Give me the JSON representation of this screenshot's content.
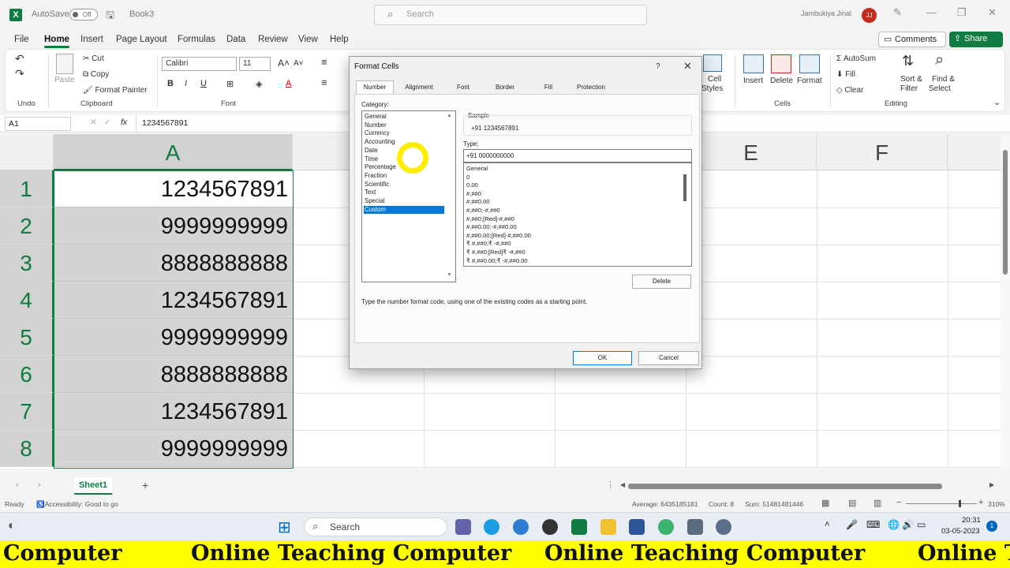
{
  "titlebar": {
    "app_icon": "X",
    "autosave_label": "AutoSave",
    "autosave_state": "Off",
    "workbook": "Book3",
    "search_placeholder": "Search",
    "user_name": "Jambukiya Jinal",
    "user_initials": "JJ"
  },
  "menu": {
    "items": [
      "File",
      "Home",
      "Insert",
      "Page Layout",
      "Formulas",
      "Data",
      "Review",
      "View",
      "Help"
    ],
    "active": "Home",
    "comments_label": "Comments",
    "share_label": "Share"
  },
  "ribbon": {
    "undo_group": "Undo",
    "clipboard": {
      "paste": "Paste",
      "cut": "Cut",
      "copy": "Copy",
      "format_painter": "Format Painter",
      "group": "Clipboard"
    },
    "font": {
      "name": "Calibri",
      "size": "11",
      "group": "Font",
      "bold": "B",
      "italic": "I",
      "underline": "U"
    },
    "cells": {
      "insert": "Insert",
      "delete": "Delete",
      "format": "Format",
      "group": "Cells",
      "cell_styles_1": "Cell",
      "cell_styles_2": "Styles"
    },
    "editing": {
      "autosum": "AutoSum",
      "fill": "Fill",
      "clear": "Clear",
      "sort_1": "Sort &",
      "sort_2": "Filter",
      "find_1": "Find &",
      "find_2": "Select",
      "group": "Editing"
    }
  },
  "formula_bar": {
    "name_box": "A1",
    "fx": "fx",
    "value": "1234567891"
  },
  "grid": {
    "columns": [
      "A",
      "E",
      "F"
    ],
    "rows": [
      "1",
      "2",
      "3",
      "4",
      "5",
      "6",
      "7",
      "8"
    ],
    "values": [
      "1234567891",
      "9999999999",
      "8888888888",
      "1234567891",
      "9999999999",
      "8888888888",
      "1234567891",
      "9999999999"
    ]
  },
  "sheets": {
    "tabs": [
      "Sheet1"
    ],
    "add": "+"
  },
  "status": {
    "ready": "Ready",
    "accessibility": "Accessibility: Good to go",
    "average": "Average: 6435185181",
    "count": "Count: 8",
    "sum": "Sum: 51481481446",
    "zoom": "310%"
  },
  "taskbar": {
    "search": "Search",
    "time": "20:31",
    "date": "03-05-2023",
    "notifications": "1"
  },
  "banner": {
    "segments": [
      "Computer",
      "Online Teaching Computer",
      "Online Teaching Computer",
      "Online T"
    ]
  },
  "dialog": {
    "title": "Format Cells",
    "help": "?",
    "close": "✕",
    "tabs": [
      "Number",
      "Alignment",
      "Font",
      "Border",
      "Fill",
      "Protection"
    ],
    "active_tab": "Number",
    "category_label": "Category:",
    "categories": [
      "General",
      "Number",
      "Currency",
      "Accounting",
      "Date",
      "Time",
      "Percentage",
      "Fraction",
      "Scientific",
      "Text",
      "Special",
      "Custom"
    ],
    "selected_category": "Custom",
    "sample_label": "Sample",
    "sample_value": "+91 1234567891",
    "type_label": "Type:",
    "type_value": "+91 0000000000",
    "format_codes": [
      "General",
      "0",
      "0.00",
      "#,##0",
      "#,##0.00",
      "#,##0;-#,##0",
      "#,##0;[Red]-#,##0",
      "#,##0.00;-#,##0.00",
      "#,##0.00;[Red]-#,##0.00",
      "₹ #,##0;₹ -#,##0",
      "₹ #,##0;[Red]₹ -#,##0",
      "₹ #,##0.00;₹ -#,##0.00"
    ],
    "delete_label": "Delete",
    "hint": "Type the number format code, using one of the existing codes as a starting point.",
    "ok_label": "OK",
    "cancel_label": "Cancel"
  }
}
